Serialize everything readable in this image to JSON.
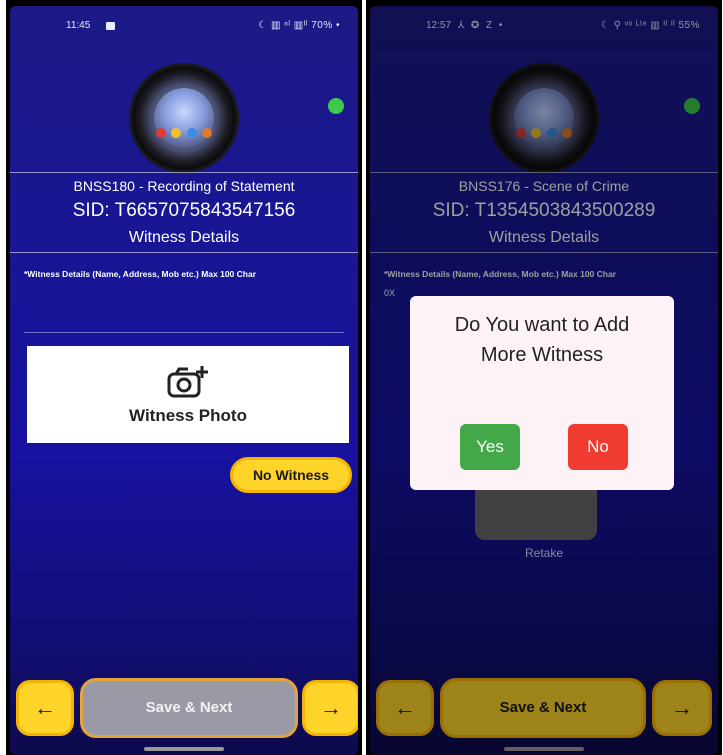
{
  "left": {
    "status": {
      "time": "11:45",
      "right": "☾ ▥ ⁿˡ ▥ᴵˡ 70% •"
    },
    "form_code": "BNSS180 - Recording of Statement",
    "sid": "SID: T6657075843547156",
    "section": "Witness Details",
    "hint": "*Witness Details (Name, Address, Mob etc.) Max 100 Char",
    "photo_label": "Witness Photo",
    "no_witness": "No Witness",
    "back": "←",
    "save": "Save & Next",
    "next": "→"
  },
  "right": {
    "status": {
      "time": "12:57",
      "notif": "⅄ ✪ Z •",
      "right": "☾ ⚲ ᵛᵒ ᴸᵗᵉ ▥ ᴵˡ ᴵˡ 55%"
    },
    "form_code": "BNSS176 - Scene of Crime",
    "sid": "SID: T1354503843500289",
    "section": "Witness Details",
    "hint": "*Witness Details (Name, Address, Mob etc.) Max 100 Char",
    "hint_value": "0X",
    "retake": "Retake",
    "dialog": {
      "question_line1": "Do You want to Add",
      "question_line2": "More Witness",
      "yes": "Yes",
      "no": "No"
    },
    "back": "←",
    "save": "Save & Next",
    "next": "→"
  },
  "colors": {
    "accent_yellow": "#ffd42a",
    "online_green": "#3ec94a",
    "yes_green": "#43a847",
    "no_red": "#ef3b30",
    "background_blue": "#1814a0"
  }
}
